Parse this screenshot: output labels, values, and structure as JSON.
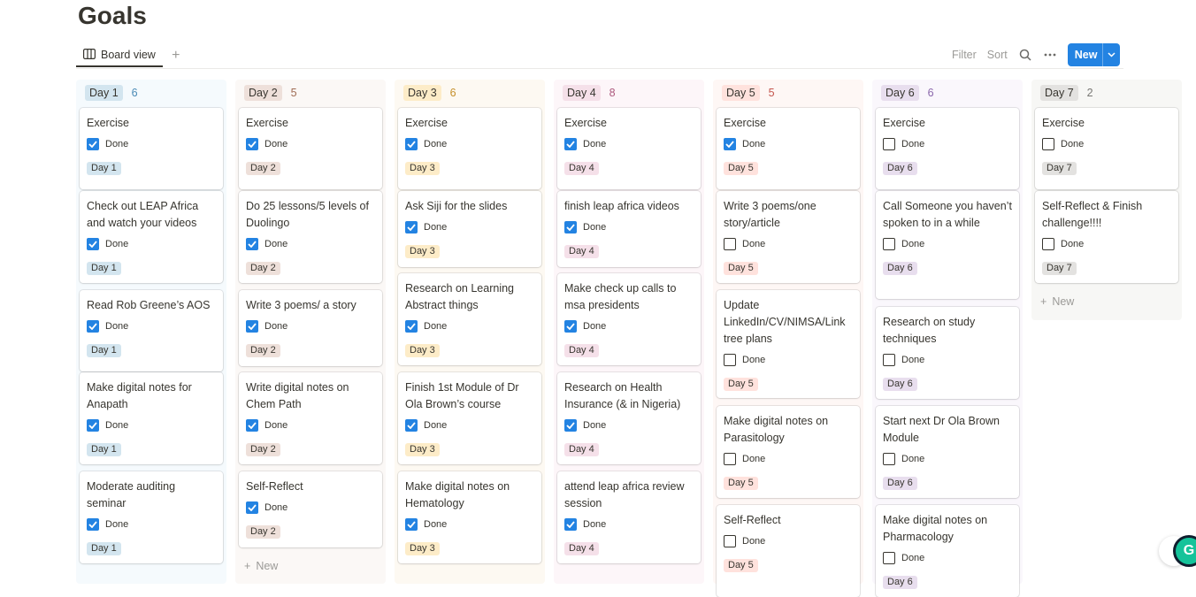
{
  "page": {
    "title": "Goals"
  },
  "view": {
    "tab_label": "Board view",
    "add_label": "+"
  },
  "toolbar": {
    "filter": "Filter",
    "sort": "Sort",
    "new_label": "New"
  },
  "columns": [
    {
      "label": "Day 1",
      "count": "6",
      "tag_bg": "#d3e5ef",
      "col_bg": "#f5fafd",
      "count_color": "#4a8ab5",
      "cards": [
        {
          "title": "Exercise",
          "done": true
        },
        {
          "title": "Check out LEAP Africa and watch your videos",
          "done": true
        },
        {
          "title": "Read Rob Greene’s AOS",
          "done": true
        },
        {
          "title": "Make digital notes for Anapath",
          "done": true
        },
        {
          "title": "Moderate auditing seminar",
          "done": true
        }
      ]
    },
    {
      "label": "Day 2",
      "count": "5",
      "tag_bg": "#eee0da",
      "col_bg": "#fbf8f6",
      "count_color": "#9f6b53",
      "cards": [
        {
          "title": "Exercise",
          "done": true
        },
        {
          "title": "Do 25 lessons/5 levels of Duolingo",
          "done": true
        },
        {
          "title": "Write 3 poems/ a story",
          "done": true
        },
        {
          "title": "Write digital notes on Chem Path",
          "done": true
        },
        {
          "title": "Self-Reflect",
          "done": true
        }
      ],
      "new_label": "New"
    },
    {
      "label": "Day 3",
      "count": "6",
      "tag_bg": "#fdecc8",
      "col_bg": "#fdf9f2",
      "count_color": "#c48f2a",
      "cards": [
        {
          "title": "Exercise",
          "done": true
        },
        {
          "title": "Ask Siji for the slides",
          "done": true
        },
        {
          "title": "Research on Learning Abstract things",
          "done": true
        },
        {
          "title": "Finish 1st Module of Dr Ola Brown’s course",
          "done": true
        },
        {
          "title": "Make digital notes on Hematology",
          "done": true
        }
      ]
    },
    {
      "label": "Day 4",
      "count": "8",
      "tag_bg": "#f5e0e9",
      "col_bg": "#fdf6f9",
      "count_color": "#ad5a7e",
      "cards": [
        {
          "title": "Exercise",
          "done": true
        },
        {
          "title": "finish leap africa videos",
          "done": true
        },
        {
          "title": "Make check up calls to msa presidents",
          "done": true
        },
        {
          "title": "Research on Health Insurance (& in Nigeria)",
          "done": true
        },
        {
          "title": "attend leap africa review session",
          "done": true
        }
      ]
    },
    {
      "label": "Day 5",
      "count": "5",
      "tag_bg": "#ffe2dd",
      "col_bg": "#fef7f5",
      "count_color": "#c4554d",
      "cards": [
        {
          "title": "Exercise",
          "done": true
        },
        {
          "title": "Write 3 poems/one story/article",
          "done": false
        },
        {
          "title": "Update LinkedIn/CV/NIMSA/Link tree plans",
          "done": false
        },
        {
          "title": "Make digital notes on Parasitology",
          "done": false
        },
        {
          "title": "Self-Reflect",
          "done": false
        }
      ]
    },
    {
      "label": "Day 6",
      "count": "6",
      "tag_bg": "#e8deee",
      "col_bg": "#faf7fc",
      "count_color": "#8a67ab",
      "cards": [
        {
          "title": "Exercise",
          "done": false
        },
        {
          "title": "Call Someone you haven’t spoken to in a while",
          "done": false
        },
        {
          "title": "Research on study techniques",
          "done": false
        },
        {
          "title": "Start next Dr Ola Brown Module",
          "done": false
        },
        {
          "title": "Make digital notes on Pharmacology",
          "done": false
        }
      ]
    },
    {
      "label": "Day 7",
      "count": "2",
      "tag_bg": "#e3e2e0",
      "col_bg": "#f7f7f5",
      "count_color": "#787774",
      "cards": [
        {
          "title": "Exercise",
          "done": false
        },
        {
          "title": "Self-Reflect & Finish challenge!!!!",
          "done": false
        }
      ],
      "new_label": "New"
    }
  ],
  "done_label": "Done"
}
